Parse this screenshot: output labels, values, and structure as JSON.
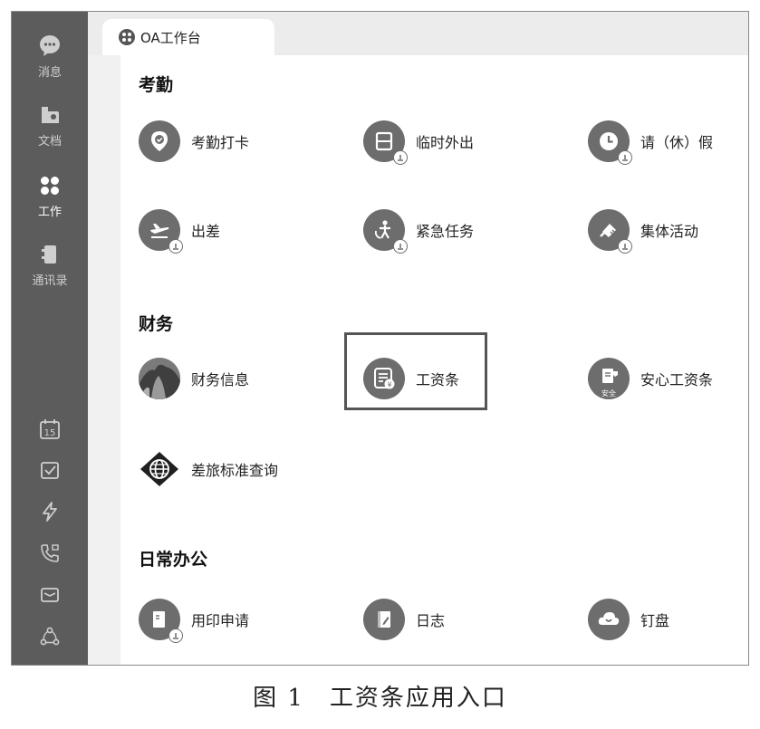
{
  "tab": {
    "title": "OA工作台"
  },
  "sidebar": {
    "items": [
      {
        "label": "消息",
        "icon": "chat-bubble-icon"
      },
      {
        "label": "文档",
        "icon": "folder-icon"
      },
      {
        "label": "工作",
        "icon": "grid-apps-icon"
      },
      {
        "label": "通讯录",
        "icon": "contacts-book-icon"
      }
    ],
    "tools": [
      "calendar-icon",
      "checkbox-icon",
      "lightning-icon",
      "phone-video-icon",
      "mail-icon",
      "network-icon"
    ],
    "calendar_day": "15"
  },
  "sections": {
    "attendance": {
      "title": "考勤",
      "apps": [
        {
          "label": "考勤打卡",
          "icon": "location-check-icon"
        },
        {
          "label": "临时外出",
          "icon": "door-icon"
        },
        {
          "label": "请（休）假",
          "icon": "clock-icon"
        },
        {
          "label": "出差",
          "icon": "airplane-icon"
        },
        {
          "label": "紧急任务",
          "icon": "person-urgent-icon"
        },
        {
          "label": "集体活动",
          "icon": "flag-icon"
        }
      ]
    },
    "finance": {
      "title": "财务",
      "apps": [
        {
          "label": "财务信息",
          "icon": "photo-thumbnail-icon"
        },
        {
          "label": "工资条",
          "icon": "payslip-icon"
        },
        {
          "label": "安心工资条",
          "icon": "safe-payslip-icon"
        },
        {
          "label": "差旅标准查询",
          "icon": "globe-icon"
        }
      ],
      "safe_badge": "安全"
    },
    "office": {
      "title": "日常办公",
      "apps": [
        {
          "label": "用印申请",
          "icon": "stamp-document-icon"
        },
        {
          "label": "日志",
          "icon": "journal-icon"
        },
        {
          "label": "钉盘",
          "icon": "cloud-icon"
        }
      ]
    }
  },
  "caption": "图 1　工资条应用入口",
  "colors": {
    "sidebar": "#5c5c5c",
    "icon": "#6d6d6d",
    "background": "#ffffff"
  }
}
